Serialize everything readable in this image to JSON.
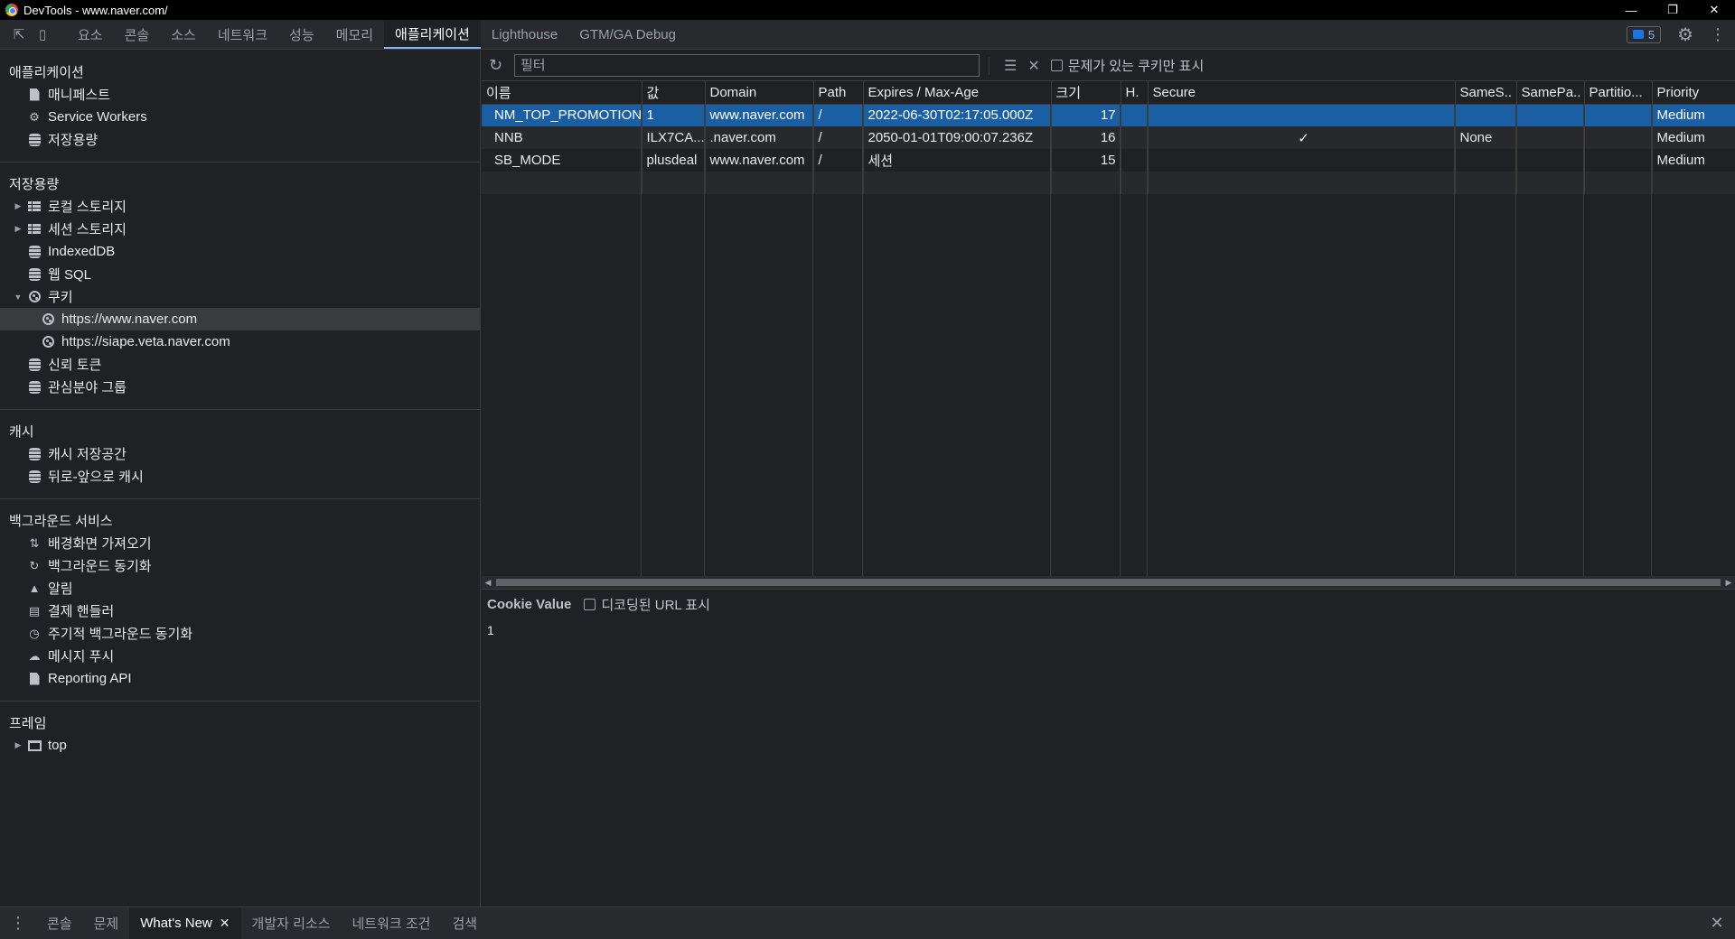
{
  "window": {
    "title": "DevTools - www.naver.com/"
  },
  "tabs": [
    "요소",
    "콘솔",
    "소스",
    "네트워크",
    "성능",
    "메모리",
    "애플리케이션",
    "Lighthouse",
    "GTM/GA Debug"
  ],
  "active_tab_index": 6,
  "issues_count": "5",
  "sidebar": {
    "application": {
      "title": "애플리케이션",
      "items": [
        {
          "label": "매니페스트",
          "icon": "document-icon"
        },
        {
          "label": "Service Workers",
          "icon": "gear-icon"
        },
        {
          "label": "저장용량",
          "icon": "database-icon"
        }
      ]
    },
    "storage": {
      "title": "저장용량",
      "local_storage": "로컬 스토리지",
      "session_storage": "세션 스토리지",
      "indexeddb": "IndexedDB",
      "websql": "웹 SQL",
      "cookies": "쿠키",
      "cookie_origins": [
        "https://www.naver.com",
        "https://siape.veta.naver.com"
      ],
      "trust_tokens": "신뢰 토큰",
      "interest_groups": "관심분야 그룹"
    },
    "cache": {
      "title": "캐시",
      "cache_storage": "캐시 저장공간",
      "bfcache": "뒤로-앞으로 캐시"
    },
    "background": {
      "title": "백그라운드 서비스",
      "items": [
        {
          "label": "배경화면 가져오기",
          "icon": "arrows-updown-icon"
        },
        {
          "label": "백그라운드 동기화",
          "icon": "sync-icon"
        },
        {
          "label": "알림",
          "icon": "bell-icon"
        },
        {
          "label": "결제 핸들러",
          "icon": "card-icon"
        },
        {
          "label": "주기적 백그라운드 동기화",
          "icon": "clock-icon"
        },
        {
          "label": "메시지 푸시",
          "icon": "cloud-icon"
        },
        {
          "label": "Reporting API",
          "icon": "document-icon"
        }
      ]
    },
    "frames": {
      "title": "프레임",
      "top": "top"
    }
  },
  "toolbar": {
    "filter_placeholder": "필터",
    "issues_only_label": "문제가 있는 쿠키만 표시"
  },
  "cookie_table": {
    "columns": [
      "이름",
      "값",
      "Domain",
      "Path",
      "Expires / Max-Age",
      "크기",
      "H.",
      "Secure",
      "SameS..",
      "SamePa..",
      "Partitio...",
      "Priority"
    ],
    "rows": [
      [
        "NM_TOP_PROMOTION",
        "1",
        "www.naver.com",
        "/",
        "2022-06-30T02:17:05.000Z",
        "17",
        "",
        "",
        "",
        "",
        "",
        "Medium"
      ],
      [
        "NNB",
        "ILX7CA...",
        ".naver.com",
        "/",
        "2050-01-01T09:00:07.236Z",
        "16",
        "",
        "✓",
        "None",
        "",
        "",
        "Medium"
      ],
      [
        "SB_MODE",
        "plusdeal",
        "www.naver.com",
        "/",
        "세션",
        "15",
        "",
        "",
        "",
        "",
        "",
        "Medium"
      ]
    ]
  },
  "cookie_value": {
    "title": "Cookie Value",
    "decoded_label": "디코딩된 URL 표시",
    "value": "1"
  },
  "drawer": {
    "tabs": [
      "콘솔",
      "문제",
      "What's New",
      "개발자 리소스",
      "네트워크 조건",
      "검색"
    ],
    "active_index": 2
  }
}
